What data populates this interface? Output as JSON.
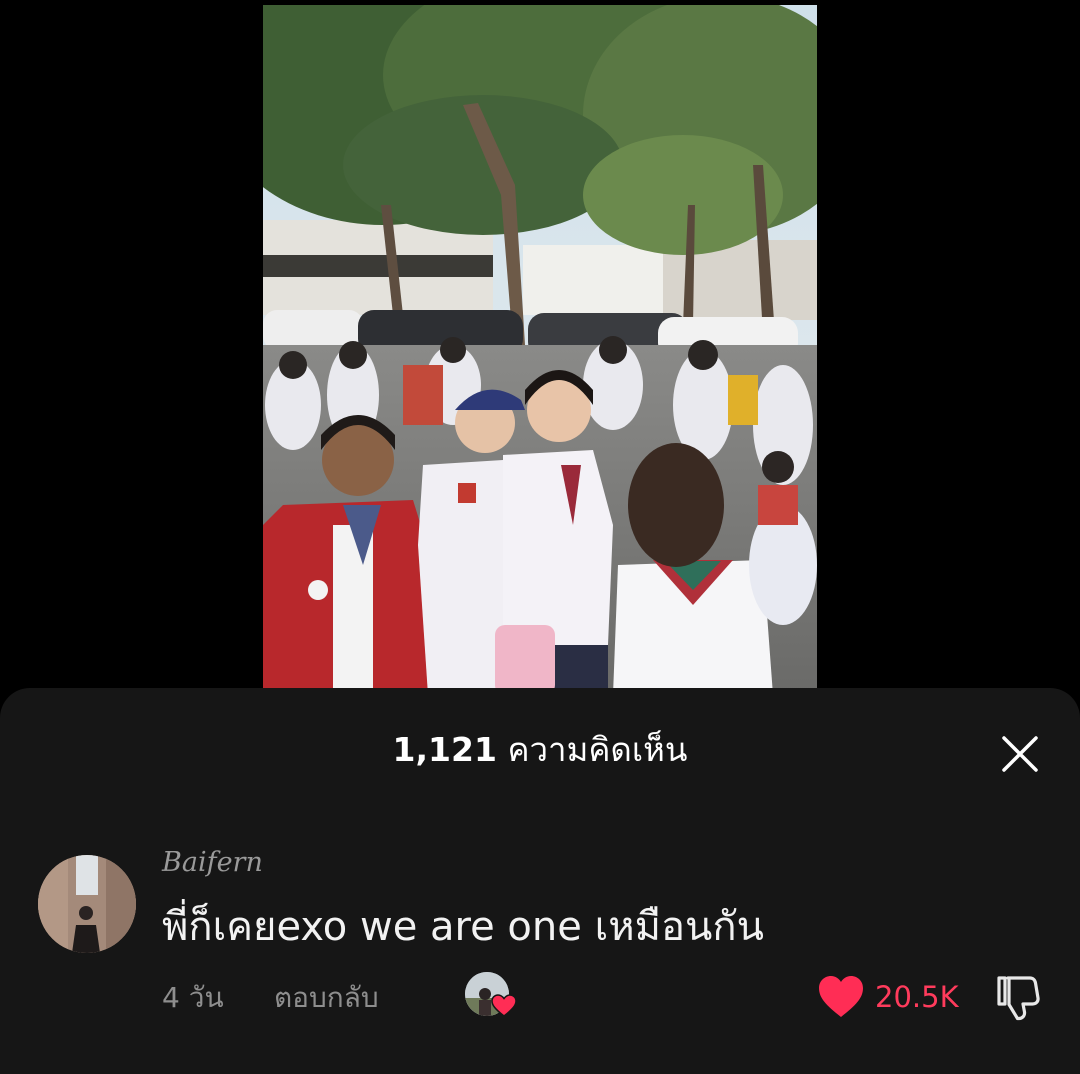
{
  "video": {
    "description_icon": "video-thumbnail-schoolyard"
  },
  "comments_sheet": {
    "count": "1,121",
    "title_suffix": "ความคิดเห็น",
    "close_icon": "close-icon"
  },
  "comment": {
    "username": "Baifern",
    "text": "พี่ก็เคยexo we are one เหมือนกัน",
    "time": "4 วัน",
    "reply_label": "ตอบกลับ",
    "like_count": "20.5K",
    "liked_by_creator": true,
    "liked": true
  },
  "colors": {
    "sheet_bg": "#161616",
    "like_red": "#ff3b5c",
    "muted_text": "#8e8e8e"
  }
}
